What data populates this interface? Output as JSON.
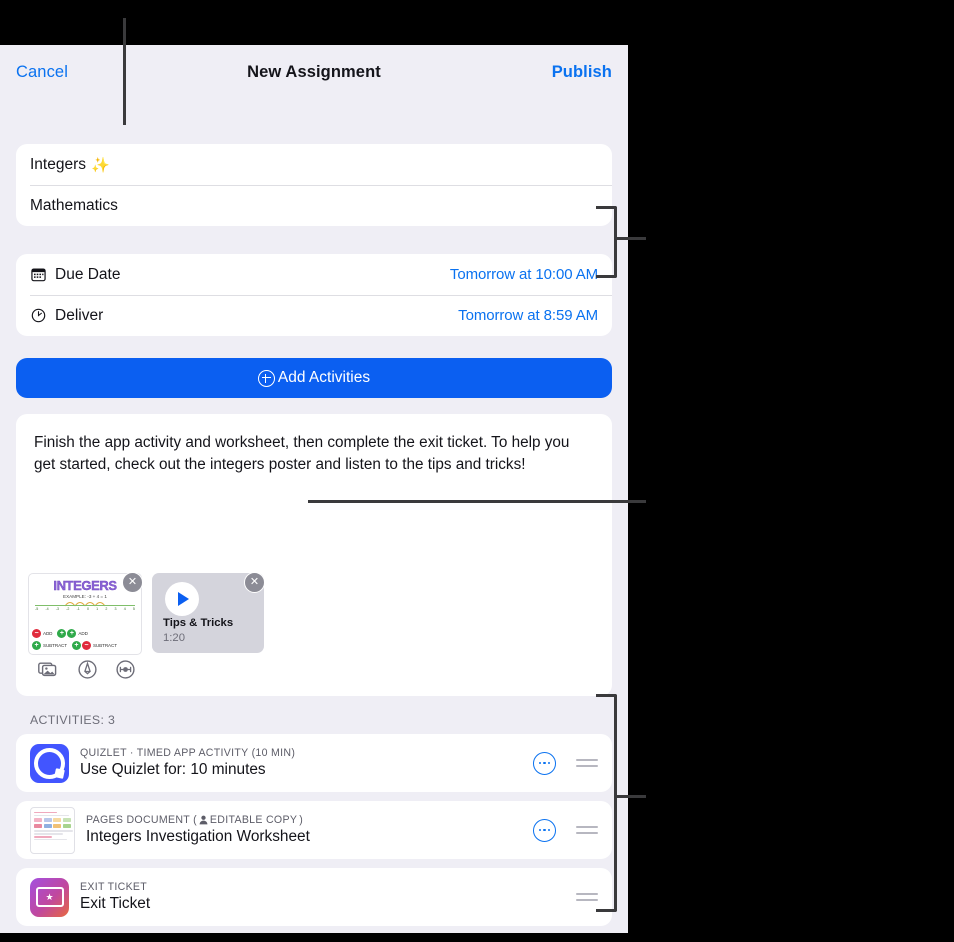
{
  "nav": {
    "cancel": "Cancel",
    "title": "New Assignment",
    "publish": "Publish"
  },
  "assignment": {
    "title": "Integers",
    "title_emoji": "✨",
    "subject": "Mathematics"
  },
  "schedule": [
    {
      "icon": "calendar-icon",
      "label": "Due Date",
      "value": "Tomorrow at 10:00 AM"
    },
    {
      "icon": "clock-icon",
      "label": "Deliver",
      "value": "Tomorrow at 8:59 AM"
    }
  ],
  "add_activities": {
    "label": "Add Activities",
    "icon": "plus-circle-icon"
  },
  "instructions": {
    "text": "Finish the app activity and worksheet, then complete the exit ticket. To help you get started, check out the integers poster and listen to the tips and tricks!",
    "attachments": [
      {
        "type": "image",
        "name": "Integers poster",
        "poster_title": "INTEGERS",
        "poster_example": "EXAMPLE:  -3 + 4 = 1",
        "ticks": [
          "-5",
          "-4",
          "-3",
          "-2",
          "-1",
          "0",
          "1",
          "2",
          "3",
          "4",
          "5"
        ],
        "legend_left": "SUBTRACT",
        "legend_right": "ADD",
        "rows": [
          {
            "sign1": "−",
            "label1": "ADD",
            "sign2": "+",
            "sign3": "+",
            "label2": "ADD"
          },
          {
            "sign1": "+",
            "label1": "SUBTRACT",
            "sign2": "+",
            "sign3": "−",
            "label2": "SUBTRACT"
          }
        ],
        "remove": "✕"
      },
      {
        "type": "audio",
        "name": "Tips & Tricks",
        "duration": "1:20",
        "remove": "✕"
      }
    ],
    "tools": [
      {
        "icon": "photo-library-icon",
        "name": "insert-photo"
      },
      {
        "icon": "markup-pen-icon",
        "name": "markup"
      },
      {
        "icon": "audio-record-icon",
        "name": "record-audio"
      }
    ]
  },
  "activities": {
    "header": "ACTIVITIES: 3",
    "items": [
      {
        "icon": "quizlet-app-icon",
        "kicker": "QUIZLET · TIMED APP ACTIVITY (10 MIN)",
        "title": "Use Quizlet for: 10 minutes",
        "has_more": true,
        "has_handle": true
      },
      {
        "icon": "pages-document-icon",
        "kicker_pre": "PAGES DOCUMENT",
        "kicker_badge": "EDITABLE COPY",
        "kicker_person_icon": "person-icon",
        "title": "Integers Investigation Worksheet",
        "has_more": true,
        "has_handle": true
      },
      {
        "icon": "exit-ticket-icon",
        "kicker": "EXIT TICKET",
        "title": "Exit Ticket",
        "has_more": false,
        "has_handle": true
      }
    ]
  },
  "colors": {
    "accent_blue": "#0a72f0",
    "button_blue": "#0b5ff1",
    "sheet_background": "#efeef5",
    "card_white": "#ffffff",
    "quizlet_blue": "#4255ff",
    "callout_line": "#3a3a3c"
  }
}
